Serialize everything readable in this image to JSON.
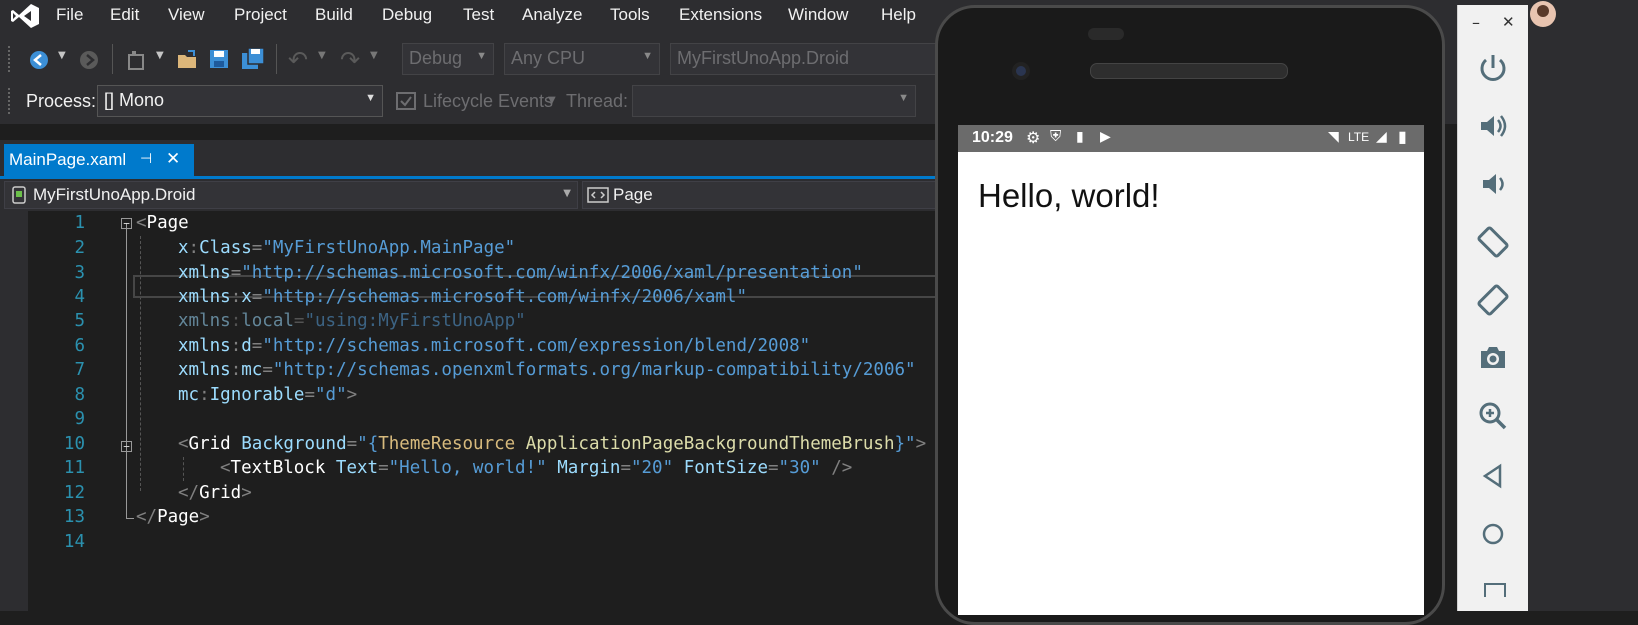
{
  "menu": [
    "File",
    "Edit",
    "View",
    "Project",
    "Build",
    "Debug",
    "Test",
    "Analyze",
    "Tools",
    "Extensions",
    "Window",
    "Help"
  ],
  "toolbar": {
    "config": "Debug",
    "platform": "Any CPU",
    "startup_project": "MyFirstUnoApp.Droid",
    "process_label": "Process:",
    "process_value": "[] Mono",
    "lifecycle_label": "Lifecycle Events",
    "thread_label": "Thread:"
  },
  "tab": {
    "label": "MainPage.xaml",
    "pin": "⊣",
    "close": "✕"
  },
  "navbar": {
    "project": "MyFirstUnoApp.Droid",
    "scope": "Page"
  },
  "editor": {
    "line_numbers": [
      "1",
      "2",
      "3",
      "4",
      "5",
      "6",
      "7",
      "8",
      "9",
      "10",
      "11",
      "12",
      "13",
      "14"
    ],
    "l1": {
      "p1": "<",
      "tag": "Page"
    },
    "l2": {
      "a": "x",
      "p": ":",
      "b": "Class",
      "eq": "=",
      "v": "\"MyFirstUnoApp.MainPage\""
    },
    "l3": {
      "a": "xmlns",
      "eq": "=",
      "v": "\"http://schemas.microsoft.com/winfx/2006/xaml/presentation\""
    },
    "l4": {
      "a": "xmlns",
      "p": ":",
      "b": "x",
      "eq": "=",
      "v": "\"http://schemas.microsoft.com/winfx/2006/xaml\""
    },
    "l5": {
      "a": "xmlns",
      "p": ":",
      "b": "local",
      "eq": "=",
      "v": "\"using:MyFirstUnoApp\""
    },
    "l6": {
      "a": "xmlns",
      "p": ":",
      "b": "d",
      "eq": "=",
      "v": "\"http://schemas.microsoft.com/expression/blend/2008\""
    },
    "l7": {
      "a": "xmlns",
      "p": ":",
      "b": "mc",
      "eq": "=",
      "v": "\"http://schemas.openxmlformats.org/markup-compatibility/2006\""
    },
    "l8": {
      "a": "mc",
      "p": ":",
      "b": "Ignorable",
      "eq": "=",
      "v": "\"d\"",
      "close": ">"
    },
    "l10": {
      "lt": "<",
      "tag": "Grid",
      "attr": "Background",
      "eq": "=",
      "q1": "\"{",
      "res": "ThemeResource",
      "key": "ApplicationPageBackgroundThemeBrush",
      "q2": "}\"",
      "gt": ">"
    },
    "l11": {
      "lt": "<",
      "tag": "TextBlock",
      "a1": "Text",
      "eq": "=",
      "v1": "\"Hello, world!\"",
      "a2": "Margin",
      "v2": "\"20\"",
      "a3": "FontSize",
      "v3": "\"30\"",
      "end": "/>"
    },
    "l12": {
      "lt": "</",
      "tag": "Grid",
      "gt": ">"
    },
    "l13": {
      "lt": "</",
      "tag": "Page",
      "gt": ">"
    }
  },
  "phone": {
    "time": "10:29",
    "network": "LTE",
    "app_text": "Hello, world!"
  },
  "emulator_panel": {
    "minimize": "–",
    "close": "✕",
    "icons": [
      "power-icon",
      "volume-up-icon",
      "volume-down-icon",
      "rotate-left-icon",
      "rotate-right-icon",
      "camera-icon",
      "zoom-icon",
      "back-icon",
      "home-icon"
    ]
  }
}
